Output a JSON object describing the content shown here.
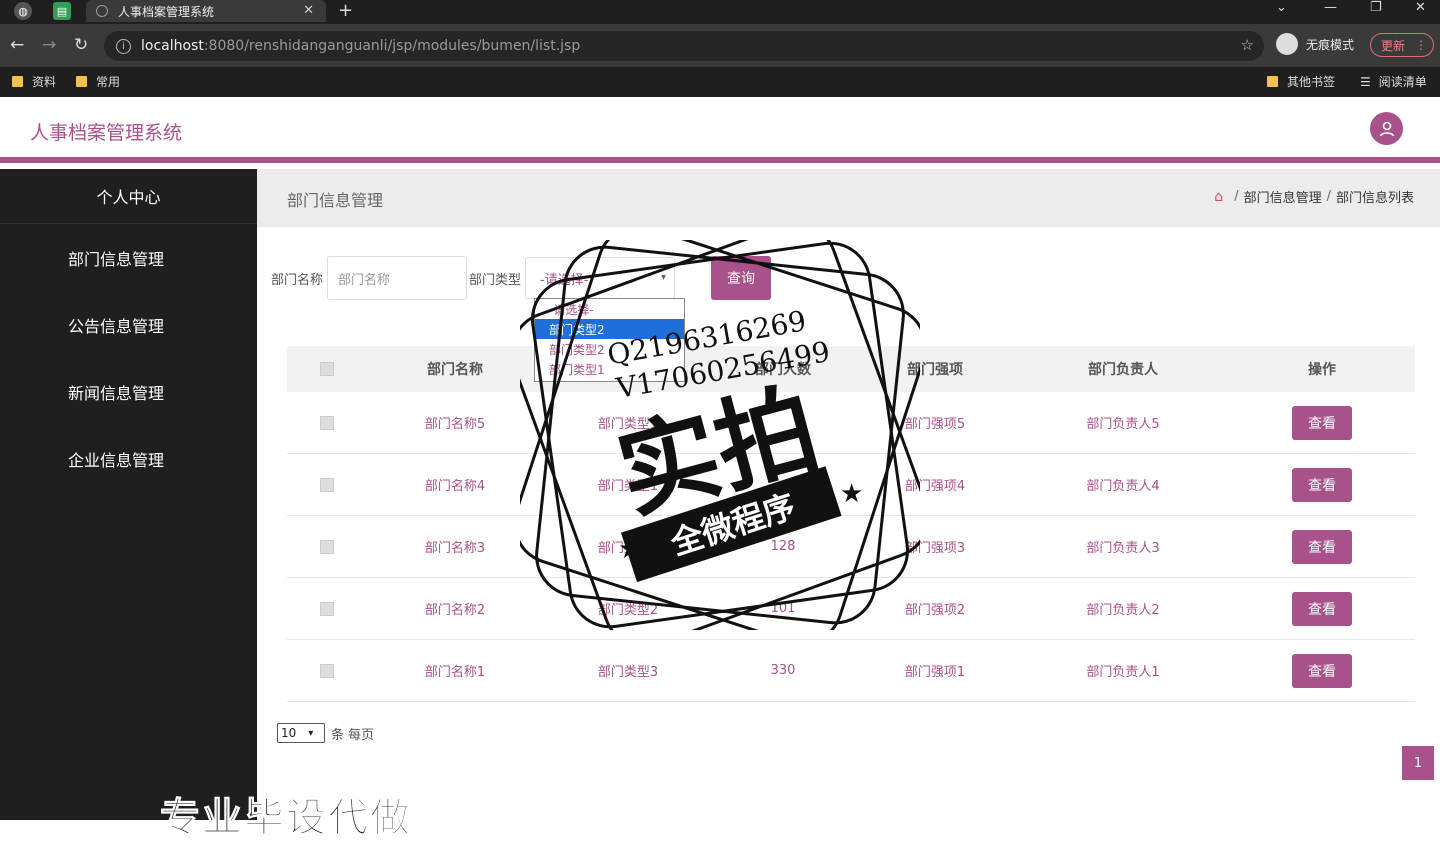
{
  "browser": {
    "tab_title": "人事档案管理系统",
    "url_host": "localhost",
    "url_path": ":8080/renshidanganguanli/jsp/modules/bumen/list.jsp",
    "incognito_label": "无痕模式",
    "update_label": "更新",
    "bookmarks": [
      "资料",
      "常用"
    ],
    "bookmarks_right": [
      "其他书签",
      "阅读清单"
    ]
  },
  "header": {
    "title": "人事档案管理系统"
  },
  "sidebar": {
    "header": "个人中心",
    "items": [
      {
        "label": "部门信息管理"
      },
      {
        "label": "公告信息管理"
      },
      {
        "label": "新闻信息管理"
      },
      {
        "label": "企业信息管理"
      }
    ]
  },
  "page": {
    "title": "部门信息管理",
    "breadcrumb": [
      "部门信息管理",
      "部门信息列表"
    ]
  },
  "search": {
    "name_label": "部门名称",
    "name_placeholder": "部门名称",
    "type_label": "部门类型",
    "type_value": "-请选择-",
    "button": "查询",
    "options": [
      "-请选择-",
      "部门类型2",
      "部门类型2",
      "部门类型1"
    ]
  },
  "table": {
    "headers": [
      "部门名称",
      "部门类型",
      "部门人数",
      "部门强项",
      "部门负责人",
      "操作"
    ],
    "rows": [
      {
        "name": "部门名称5",
        "type": "部门类型1",
        "count": "",
        "strength": "部门强项5",
        "leader": "部门负责人5",
        "action": "查看"
      },
      {
        "name": "部门名称4",
        "type": "部门类型1",
        "count": "",
        "strength": "部门强项4",
        "leader": "部门负责人4",
        "action": "查看"
      },
      {
        "name": "部门名称3",
        "type": "部门类型1",
        "count": "128",
        "strength": "部门强项3",
        "leader": "部门负责人3",
        "action": "查看"
      },
      {
        "name": "部门名称2",
        "type": "部门类型2",
        "count": "101",
        "strength": "部门强项2",
        "leader": "部门负责人2",
        "action": "查看"
      },
      {
        "name": "部门名称1",
        "type": "部门类型3",
        "count": "330",
        "strength": "部门强项1",
        "leader": "部门负责人1",
        "action": "查看"
      }
    ]
  },
  "pagination": {
    "page_size": "10",
    "per_page_label": "条 每页",
    "current_page": "1"
  },
  "watermark": {
    "qq": "Q2196316269",
    "phone": "V17060256499",
    "big": "实拍",
    "banner": "全微程序",
    "bottom": "专业毕设代做"
  },
  "colors": {
    "accent": "#a8518a",
    "sidebar": "#1f1f1f"
  }
}
